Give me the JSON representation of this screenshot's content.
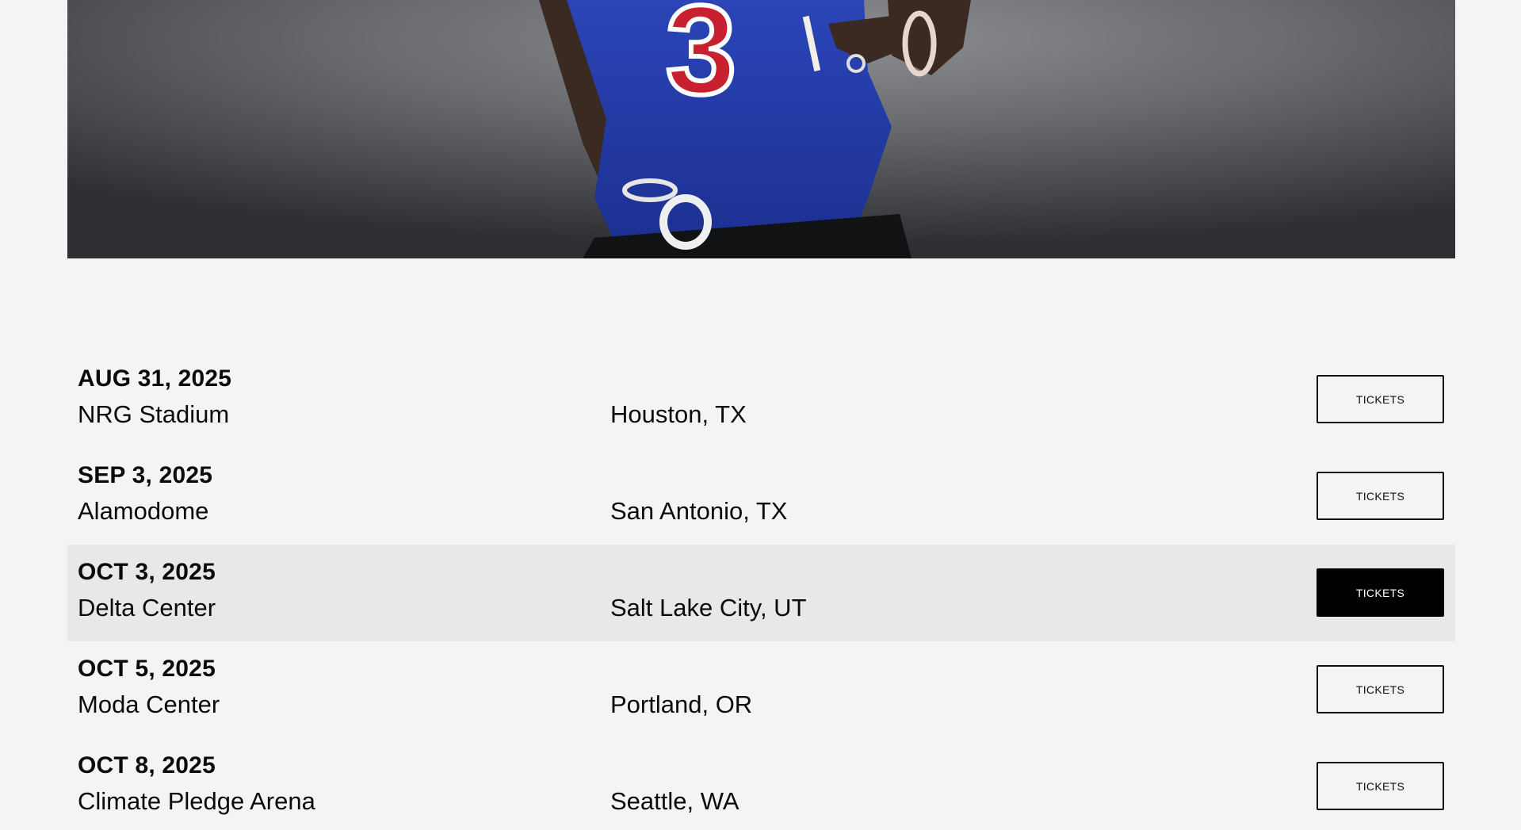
{
  "hero": {
    "jersey_number": "3"
  },
  "tour": {
    "button_label": "TICKETS",
    "dates": [
      {
        "date": "AUG 31, 2025",
        "venue": "NRG Stadium",
        "city": "Houston, TX"
      },
      {
        "date": "SEP 3, 2025",
        "venue": "Alamodome",
        "city": "San Antonio, TX"
      },
      {
        "date": "OCT 3, 2025",
        "venue": "Delta Center",
        "city": "Salt Lake City, UT"
      },
      {
        "date": "OCT 5, 2025",
        "venue": "Moda Center",
        "city": "Portland, OR"
      },
      {
        "date": "OCT 8, 2025",
        "venue": "Climate Pledge Arena",
        "city": "Seattle, WA"
      }
    ]
  }
}
